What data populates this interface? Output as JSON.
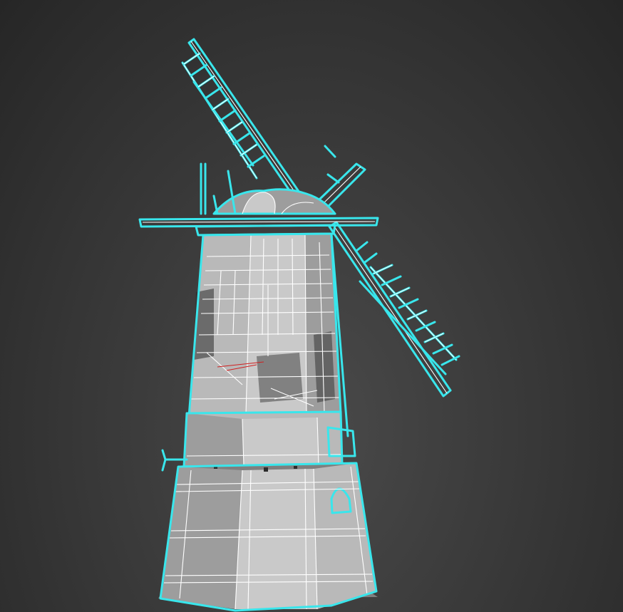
{
  "viewport": {
    "background_color": "#333333",
    "selection_color": "#39e6ec",
    "wire_color": "#ffffff",
    "mesh_color": "#b9b9b9",
    "selected_object": "windmill"
  }
}
